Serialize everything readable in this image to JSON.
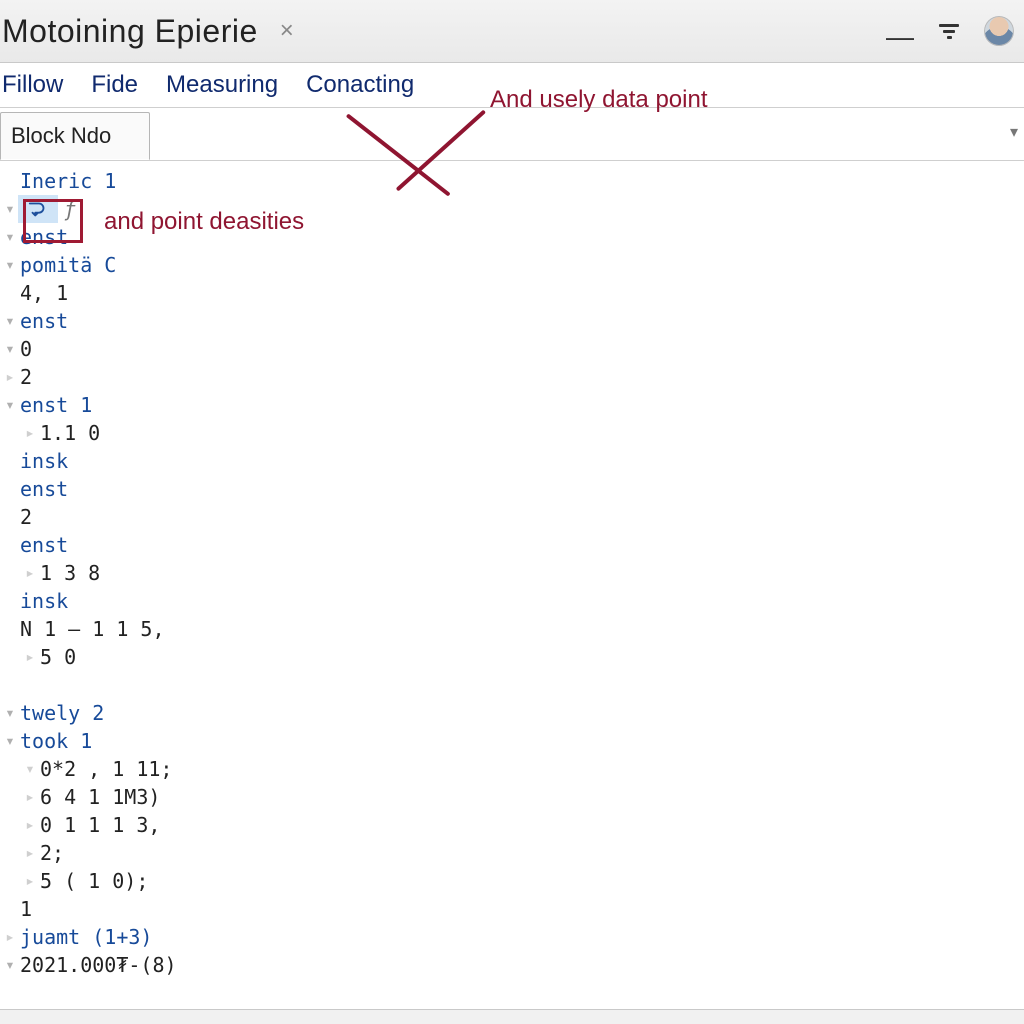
{
  "titlebar": {
    "title": "Motoining Epierie",
    "close_glyph": "×",
    "minimize_glyph": "—"
  },
  "menubar": {
    "items": [
      "Fillow",
      "Fide",
      "Measuring",
      "Conacting"
    ]
  },
  "tabs": {
    "active_label": "Block Ndo"
  },
  "annotations": {
    "top_label": "And usely data point",
    "side_label": "and point deasities"
  },
  "tree": {
    "rows": [
      {
        "label": "Ineric 1"
      },
      {
        "badge": "ƒ"
      },
      {
        "label": "enst"
      },
      {
        "label": "pomitä C"
      },
      {
        "label": "4, 1"
      },
      {
        "label": "enst"
      },
      {
        "label": "0"
      },
      {
        "label": "2"
      },
      {
        "label": "enst 1"
      },
      {
        "label": "1.1 0"
      },
      {
        "label": "insk"
      },
      {
        "label": "enst"
      },
      {
        "label": "2"
      },
      {
        "label": "enst"
      },
      {
        "label": "1 3 8"
      },
      {
        "label": "insk"
      },
      {
        "label": "N 1 – 1 1 5,"
      },
      {
        "label": "5 0"
      },
      {
        "label": "twely 2"
      },
      {
        "label": "took 1"
      },
      {
        "label": "0*2 , 1 11;"
      },
      {
        "label": "6 4 1 1M3)"
      },
      {
        "label": "0 1 1 1 3,"
      },
      {
        "label": "2;"
      },
      {
        "label": "5 ( 1 0);"
      },
      {
        "label": "1"
      },
      {
        "label": "juamt (1+3)"
      },
      {
        "label": "2021.000₮-(8)"
      }
    ]
  }
}
